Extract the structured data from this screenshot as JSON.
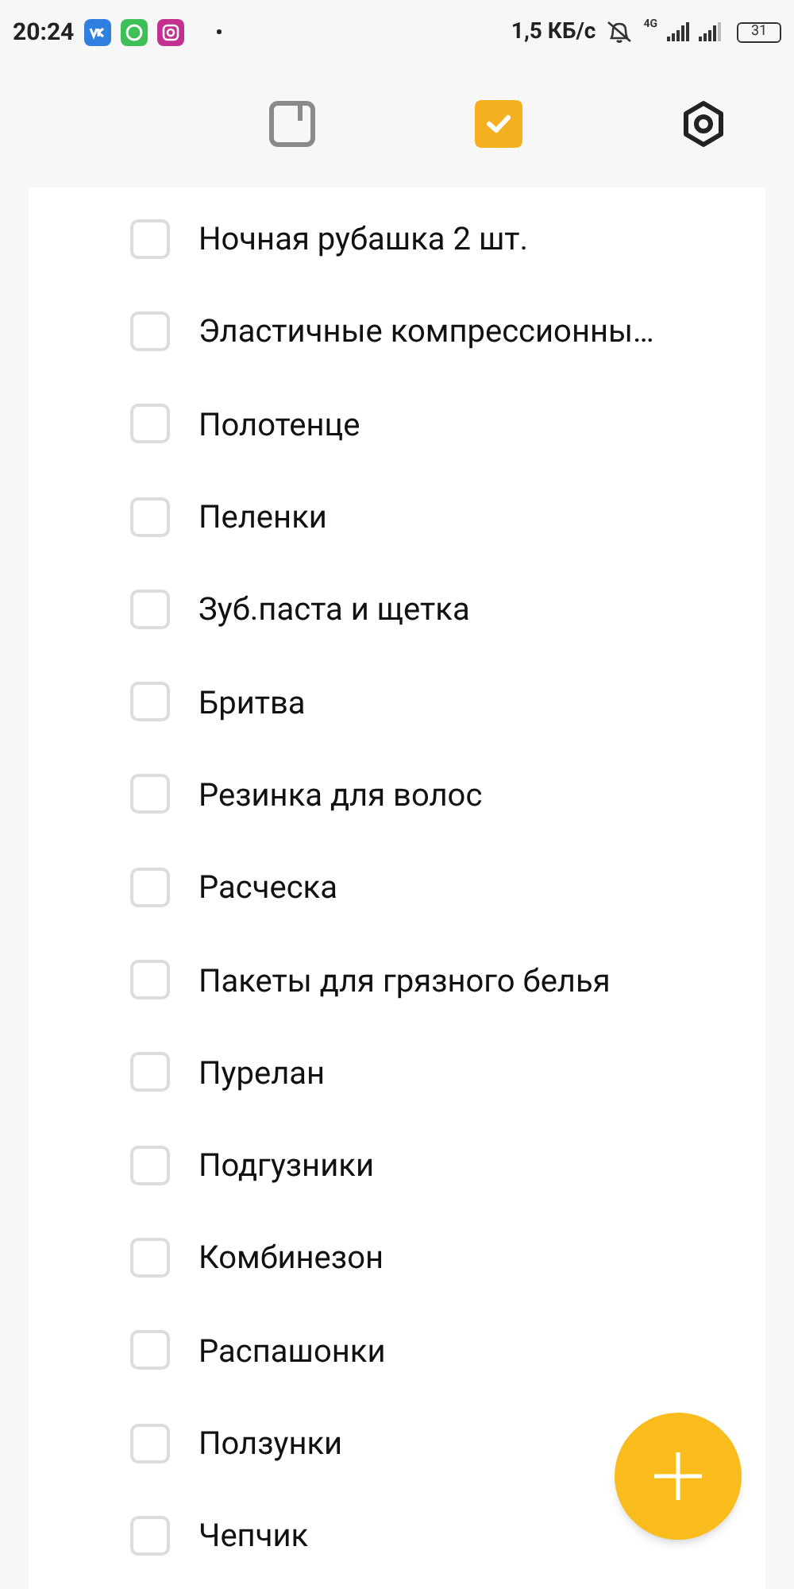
{
  "status_bar": {
    "time": "20:24",
    "speed": "1,5 КБ/с",
    "network": "4G",
    "battery": "31"
  },
  "tabs": [
    {
      "kind": "notes",
      "selected": false
    },
    {
      "kind": "checklist",
      "selected": true
    },
    {
      "kind": "settings",
      "selected": false
    }
  ],
  "items": [
    {
      "text": "Ночная рубашка 2 шт.",
      "checked": false
    },
    {
      "text": "Эластичные компрессионны…",
      "checked": false
    },
    {
      "text": "Полотенце",
      "checked": false
    },
    {
      "text": "Пеленки",
      "checked": false
    },
    {
      "text": "Зуб.паста и щетка",
      "checked": false
    },
    {
      "text": "Бритва",
      "checked": false
    },
    {
      "text": "Резинка для волос",
      "checked": false
    },
    {
      "text": "Расческа",
      "checked": false
    },
    {
      "text": "Пакеты для грязного белья",
      "checked": false
    },
    {
      "text": "Пурелан",
      "checked": false
    },
    {
      "text": "Подгузники",
      "checked": false
    },
    {
      "text": "Комбинезон",
      "checked": false
    },
    {
      "text": "Распашонки",
      "checked": false
    },
    {
      "text": "Ползунки",
      "checked": false
    },
    {
      "text": "Чепчик",
      "checked": false
    }
  ]
}
